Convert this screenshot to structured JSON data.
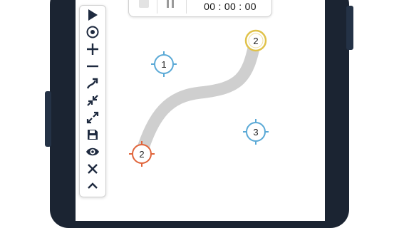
{
  "timer": {
    "time": "00 : 00 : 00"
  },
  "toolbar": {
    "tools": [
      "play-icon",
      "target-icon",
      "plus-icon",
      "minus-icon",
      "route-icon",
      "collapse-icon",
      "expand-icon",
      "save-icon",
      "eye-icon",
      "close-icon",
      "chevron-up-icon"
    ]
  },
  "markers": [
    {
      "label": "1",
      "color": "#5aa9d6"
    },
    {
      "label": "2",
      "color": "#e0c24a"
    },
    {
      "label": "3",
      "color": "#5aa9d6"
    },
    {
      "label": "2",
      "color": "#e0643a"
    }
  ],
  "colors": {
    "accent_dark": "#1e2a3f",
    "path": "#cfcfcf",
    "frame": "#1b2432"
  }
}
